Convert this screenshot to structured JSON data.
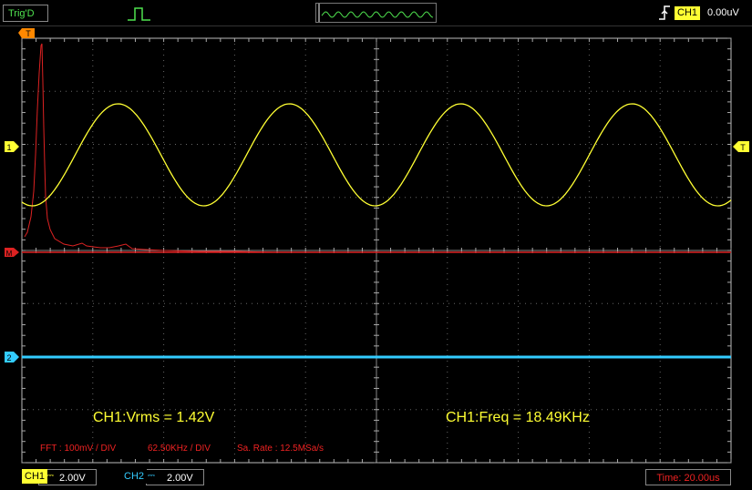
{
  "top_bar": {
    "trig_status": "Trig'D",
    "trigger_channel": "CH1",
    "trigger_level": "0.00uV"
  },
  "markers": {
    "trigger_position": "T",
    "ch1": "1",
    "math": "M",
    "ch2": "2",
    "trigger_level": "T"
  },
  "measurements": {
    "vrms": "CH1:Vrms = 1.42V",
    "freq": "CH1:Freq = 18.49KHz"
  },
  "fft": {
    "scale": "FFT :  100mV / DIV",
    "freq_div": "62.50KHz / DIV",
    "sample_rate": "Sa. Rate : 12.5MSa/s"
  },
  "bottom_bar": {
    "ch1_label": "CH1",
    "ch1_volts": "2.00V",
    "ch2_label": "CH2",
    "ch2_volts": "2.00V",
    "time": "Time: 20.00us"
  },
  "colors": {
    "ch1": "#ffff33",
    "ch2": "#33ccff",
    "math": "#dd2222",
    "grid": "#777777",
    "trigger_marker": "#ff8800"
  },
  "icons": {
    "trigger_mode": "pulse-icon",
    "timebase": "waveform-preview-icon",
    "trigger_edge": "rising-edge-icon"
  }
}
